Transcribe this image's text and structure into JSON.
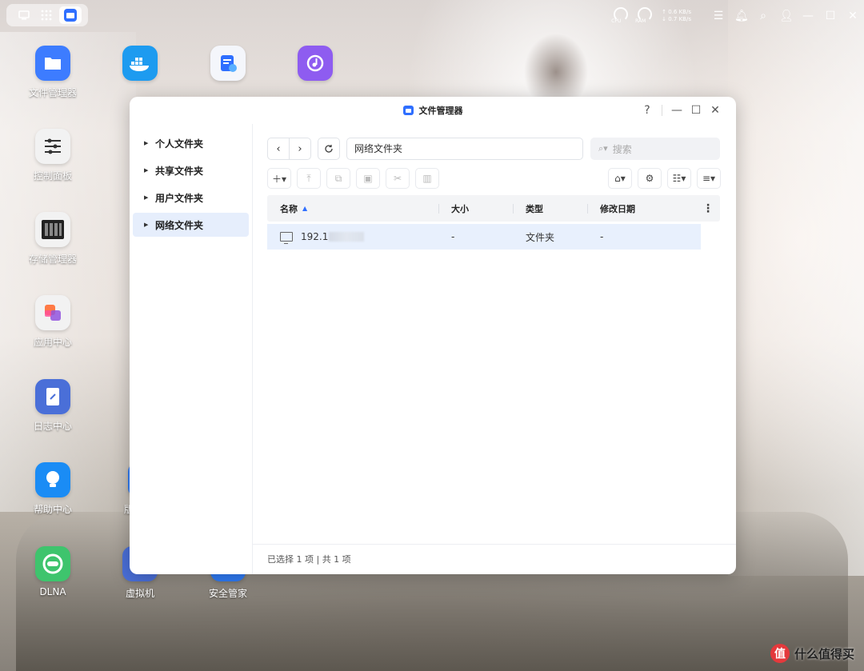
{
  "topbar": {
    "cpu_label": "CPU",
    "ram_label": "RAM",
    "upload_speed": "0.6 KB/s",
    "download_speed": "0.7 KB/s"
  },
  "desktop": {
    "icons": [
      {
        "label": "文件管理器",
        "icon": "folder-icon",
        "color": "#3d7cff"
      },
      {
        "label": "控制面板",
        "icon": "sliders-icon",
        "color": "#f2f2f2"
      },
      {
        "label": "存储管理器",
        "icon": "storage-icon",
        "color": "#f2f2f2"
      },
      {
        "label": "应用中心",
        "icon": "app-center-icon",
        "color": "#f2f2f2"
      },
      {
        "label": "日志中心",
        "icon": "log-icon",
        "color": "#4a6fd8"
      },
      {
        "label": "帮助中心",
        "icon": "lightbulb-icon",
        "color": "#1a8cf5"
      },
      {
        "label": "DLNA",
        "icon": "dlna-icon",
        "color": "#3ec46d"
      },
      {
        "label": "版本",
        "icon": "version-icon",
        "color": "#2f7bf5"
      },
      {
        "label": "虚拟机",
        "icon": "vm-icon",
        "color": "#4a6fd8"
      },
      {
        "label": "安全管家",
        "icon": "shield-icon",
        "color": "#2f7bf5"
      }
    ]
  },
  "window": {
    "title": "文件管理器",
    "help": "?",
    "sidebar": [
      {
        "label": "个人文件夹"
      },
      {
        "label": "共享文件夹"
      },
      {
        "label": "用户文件夹"
      },
      {
        "label": "网络文件夹"
      }
    ],
    "path": "网络文件夹",
    "search_placeholder": "搜索",
    "columns": [
      "名称",
      "大小",
      "类型",
      "修改日期"
    ],
    "rows": [
      {
        "name": "192.1",
        "size": "-",
        "type": "文件夹",
        "modified": "-"
      }
    ],
    "status": "已选择 1 项 | 共 1 项"
  },
  "watermark": {
    "badge": "值",
    "text": "什么值得买"
  }
}
